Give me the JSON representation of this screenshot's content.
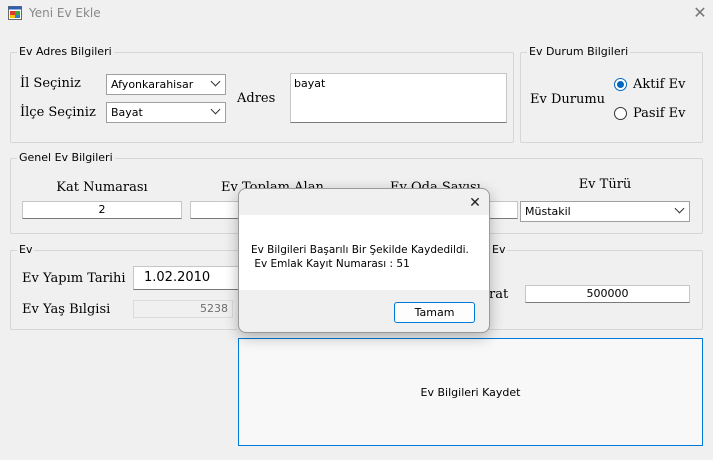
{
  "window": {
    "title": "Yeni Ev Ekle",
    "close_glyph": "✕"
  },
  "address_group": {
    "title": "Ev Adres Bilgileri",
    "il_label": "İl Seçiniz",
    "il_value": "Afyonkarahisar",
    "ilce_label": "İlçe Seçiniz",
    "ilce_value": "Bayat",
    "adres_label": "Adres",
    "adres_value": "bayat"
  },
  "status_group": {
    "title": "Ev Durum Bilgileri",
    "label": "Ev Durumu",
    "options": [
      "Aktif Ev",
      "Pasif Ev"
    ],
    "selected": "Aktif Ev"
  },
  "general_group": {
    "title": "Genel Ev Bilgileri",
    "kat_label": "Kat Numarası",
    "kat_value": "2",
    "alan_label": "Ev Toplam Alan",
    "oda_label": "Ev Oda Sayısı",
    "tur_label": "Ev Türü",
    "tur_value": "Müstakil"
  },
  "age_group": {
    "title": "Ev",
    "yapim_label": "Ev Yapım Tarihi",
    "yapim_value": "1.02.2010",
    "yas_label": "Ev Yaş Bılgisi",
    "yas_value": "5238"
  },
  "price_group": {
    "title": "Ev",
    "label": "rat",
    "value": "500000"
  },
  "save_button": {
    "label": "Ev Bilgileri Kaydet"
  },
  "message_box": {
    "close_glyph": "✕",
    "message": "Ev Bilgileri Başarılı Bir Şekilde Kaydedildi.\n Ev Emlak Kayıt Numarası : 51",
    "ok_label": "Tamam"
  },
  "colors": {
    "accent": "#0078d7",
    "radio_selected": "#0067c0",
    "background": "#f0f0f0"
  },
  "icons": [
    "app-icon",
    "close-icon",
    "chevron-down-icon"
  ]
}
